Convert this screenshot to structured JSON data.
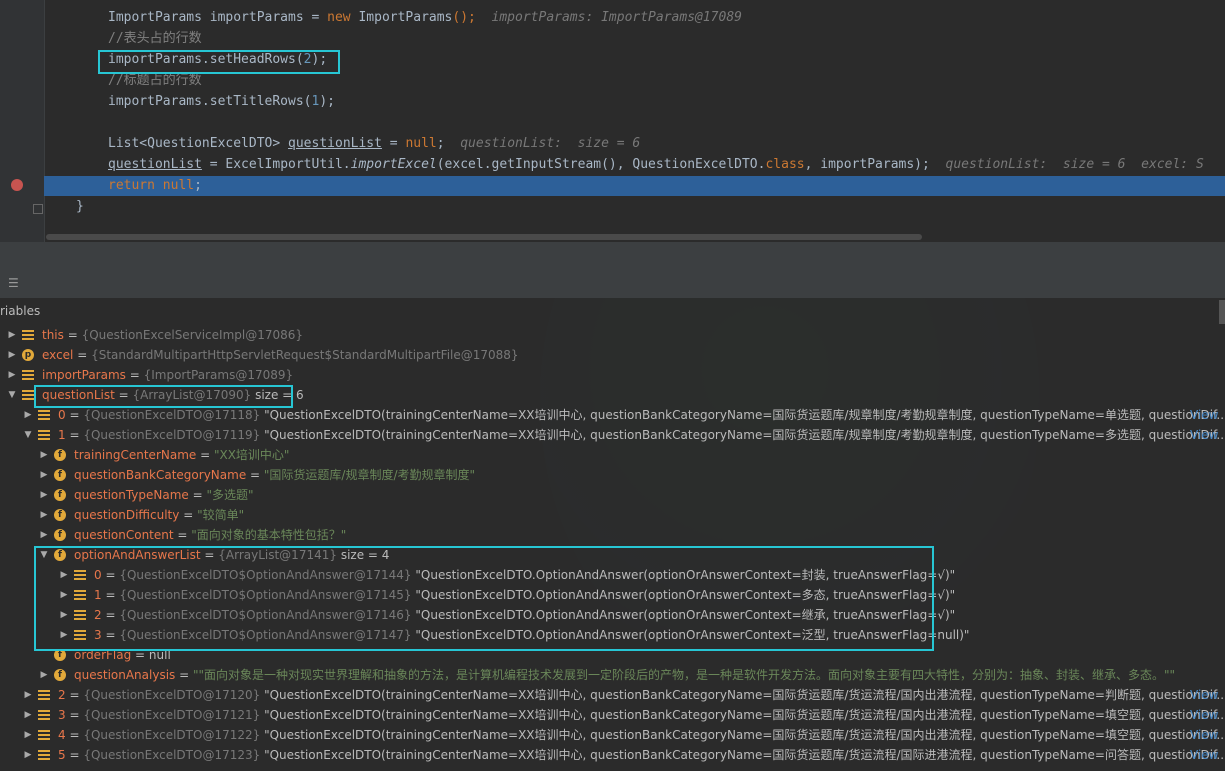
{
  "editor": {
    "lines": [
      {
        "id": "l1",
        "parts": [
          {
            "t": "ImportParams importParams = "
          },
          {
            "t": "new",
            "c": "kw"
          },
          {
            "t": " ImportParams"
          },
          {
            "t": "();",
            "c": "kw"
          },
          {
            "t": "  importParams: ImportParams@17089",
            "c": "hint"
          }
        ]
      },
      {
        "id": "l2",
        "parts": [
          {
            "t": "//表头占的行数",
            "c": "cm"
          }
        ]
      },
      {
        "id": "l3",
        "parts": [
          {
            "t": "importParams.setHeadRows("
          },
          {
            "t": "2",
            "c": "num"
          },
          {
            "t": ");"
          }
        ]
      },
      {
        "id": "l4",
        "parts": [
          {
            "t": "//标题占的行数",
            "c": "cm"
          }
        ]
      },
      {
        "id": "l5",
        "parts": [
          {
            "t": "importParams.setTitleRows("
          },
          {
            "t": "1",
            "c": "num"
          },
          {
            "t": ");"
          }
        ]
      },
      {
        "id": "l6",
        "parts": [
          {
            "t": ""
          }
        ]
      },
      {
        "id": "l7",
        "parts": [
          {
            "t": "List<"
          },
          {
            "t": "QuestionExcelDTO> "
          },
          {
            "t": "questionList",
            "c": "ul"
          },
          {
            "t": " = "
          },
          {
            "t": "null",
            "c": "kw"
          },
          {
            "t": ";  "
          },
          {
            "t": "questionList:  size = 6",
            "c": "hint"
          }
        ]
      },
      {
        "id": "l8",
        "parts": [
          {
            "t": "questionList",
            "c": "ul"
          },
          {
            "t": " = ExcelImportUtil."
          },
          {
            "t": "importExcel",
            "c": "it"
          },
          {
            "t": "(excel.getInputStream(), QuestionExcelDTO."
          },
          {
            "t": "class",
            "c": "kw"
          },
          {
            "t": ", importParams);  "
          },
          {
            "t": "questionList:  size = 6  excel: S",
            "c": "hint"
          }
        ]
      },
      {
        "id": "l9",
        "parts": [
          {
            "t": "return",
            "c": "kw"
          },
          {
            "t": " "
          },
          {
            "t": "null",
            "c": "kw"
          },
          {
            "t": ";"
          }
        ]
      },
      {
        "id": "l10",
        "parts": [
          {
            "t": "}"
          }
        ]
      }
    ]
  },
  "panel": {
    "title": "riables"
  },
  "variables": [
    {
      "level": 0,
      "expanded": false,
      "icon": "list-icon",
      "name": "this",
      "ref": "{QuestionExcelServiceImpl@17086}",
      "value": "",
      "view": ""
    },
    {
      "level": 0,
      "expanded": false,
      "icon": "p-icon",
      "name": "excel",
      "ref": "{StandardMultipartHttpServletRequest$StandardMultipartFile@17088}",
      "value": "",
      "view": ""
    },
    {
      "level": 0,
      "expanded": false,
      "icon": "list-icon",
      "name": "importParams",
      "ref": "{ImportParams@17089}",
      "value": "",
      "view": ""
    },
    {
      "level": 0,
      "expanded": true,
      "icon": "list-icon",
      "name": "questionList",
      "ref": "{ArrayList@17090}",
      "value": "size = 6",
      "view": ""
    },
    {
      "level": 1,
      "expanded": false,
      "icon": "list-icon",
      "name": "0",
      "ref": "{QuestionExcelDTO@17118}",
      "value": "\"QuestionExcelDTO(trainingCenterName=XX培训中心, questionBankCategoryName=国际货运题库/规章制度/考勤规章制度, questionTypeName=单选题, questionDif...",
      "view": "View"
    },
    {
      "level": 1,
      "expanded": true,
      "icon": "list-icon",
      "name": "1",
      "ref": "{QuestionExcelDTO@17119}",
      "value": "\"QuestionExcelDTO(trainingCenterName=XX培训中心, questionBankCategoryName=国际货运题库/规章制度/考勤规章制度, questionTypeName=多选题, questionDif...",
      "view": "View"
    },
    {
      "level": 2,
      "expanded": false,
      "icon": "f-icon",
      "name": "trainingCenterName",
      "ref": "",
      "value": "\"XX培训中心\"",
      "view": ""
    },
    {
      "level": 2,
      "expanded": false,
      "icon": "f-icon",
      "name": "questionBankCategoryName",
      "ref": "",
      "value": "\"国际货运题库/规章制度/考勤规章制度\"",
      "view": ""
    },
    {
      "level": 2,
      "expanded": false,
      "icon": "f-icon",
      "name": "questionTypeName",
      "ref": "",
      "value": "\"多选题\"",
      "view": ""
    },
    {
      "level": 2,
      "expanded": false,
      "icon": "f-icon",
      "name": "questionDifficulty",
      "ref": "",
      "value": "\"较简单\"",
      "view": ""
    },
    {
      "level": 2,
      "expanded": false,
      "icon": "f-icon",
      "name": "questionContent",
      "ref": "",
      "value": "\"面向对象的基本特性包括？\"",
      "view": ""
    },
    {
      "level": 2,
      "expanded": true,
      "icon": "f-icon",
      "name": "optionAndAnswerList",
      "ref": "{ArrayList@17141}",
      "value": "size = 4",
      "view": ""
    },
    {
      "level": 3,
      "expanded": false,
      "icon": "list-icon",
      "name": "0",
      "ref": "{QuestionExcelDTO$OptionAndAnswer@17144}",
      "value": "\"QuestionExcelDTO.OptionAndAnswer(optionOrAnswerContext=封装, trueAnswerFlag=√)\"",
      "view": ""
    },
    {
      "level": 3,
      "expanded": false,
      "icon": "list-icon",
      "name": "1",
      "ref": "{QuestionExcelDTO$OptionAndAnswer@17145}",
      "value": "\"QuestionExcelDTO.OptionAndAnswer(optionOrAnswerContext=多态, trueAnswerFlag=√)\"",
      "view": ""
    },
    {
      "level": 3,
      "expanded": false,
      "icon": "list-icon",
      "name": "2",
      "ref": "{QuestionExcelDTO$OptionAndAnswer@17146}",
      "value": "\"QuestionExcelDTO.OptionAndAnswer(optionOrAnswerContext=继承, trueAnswerFlag=√)\"",
      "view": ""
    },
    {
      "level": 3,
      "expanded": false,
      "icon": "list-icon",
      "name": "3",
      "ref": "{QuestionExcelDTO$OptionAndAnswer@17147}",
      "value": "\"QuestionExcelDTO.OptionAndAnswer(optionOrAnswerContext=泛型, trueAnswerFlag=null)\"",
      "view": ""
    },
    {
      "level": 2,
      "expanded": null,
      "icon": "f-icon",
      "name": "orderFlag",
      "ref": "",
      "value": "null",
      "view": ""
    },
    {
      "level": 2,
      "expanded": false,
      "icon": "f-icon",
      "name": "questionAnalysis",
      "ref": "",
      "value": "\"\"面向对象是一种对现实世界理解和抽象的方法，是计算机编程技术发展到一定阶段后的产物，是一种是软件开发方法。面向对象主要有四大特性，分别为：抽象、封装、继承、多态。\"\"",
      "view": ""
    },
    {
      "level": 1,
      "expanded": false,
      "icon": "list-icon",
      "name": "2",
      "ref": "{QuestionExcelDTO@17120}",
      "value": "\"QuestionExcelDTO(trainingCenterName=XX培训中心, questionBankCategoryName=国际货运题库/货运流程/国内出港流程, questionTypeName=判断题, questionDif...",
      "view": "View"
    },
    {
      "level": 1,
      "expanded": false,
      "icon": "list-icon",
      "name": "3",
      "ref": "{QuestionExcelDTO@17121}",
      "value": "\"QuestionExcelDTO(trainingCenterName=XX培训中心, questionBankCategoryName=国际货运题库/货运流程/国内出港流程, questionTypeName=填空题, questionDif...",
      "view": "View"
    },
    {
      "level": 1,
      "expanded": false,
      "icon": "list-icon",
      "name": "4",
      "ref": "{QuestionExcelDTO@17122}",
      "value": "\"QuestionExcelDTO(trainingCenterName=XX培训中心, questionBankCategoryName=国际货运题库/货运流程/国内出港流程, questionTypeName=填空题, questionDif...",
      "view": "View"
    },
    {
      "level": 1,
      "expanded": false,
      "icon": "list-icon",
      "name": "5",
      "ref": "{QuestionExcelDTO@17123}",
      "value": "\"QuestionExcelDTO(trainingCenterName=XX培训中心, questionBankCategoryName=国际货运题库/货运流程/国际进港流程, questionTypeName=问答题, questionDif...",
      "view": "View"
    }
  ],
  "colors": {
    "highlight_box": "#27c6d4",
    "execution_line": "#2d6099",
    "string_value": "#6a8759",
    "field_name": "#e8774b"
  }
}
